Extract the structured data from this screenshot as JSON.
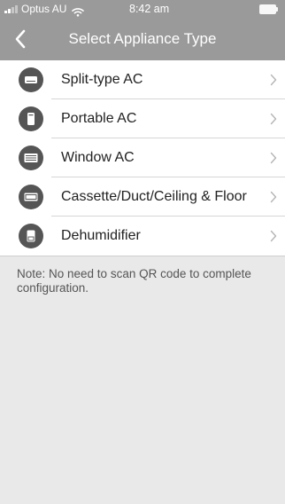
{
  "status_bar": {
    "carrier": "Optus AU",
    "time": "8:42 am",
    "icons": [
      "signal-icon",
      "wifi-icon",
      "battery-icon"
    ]
  },
  "nav": {
    "title": "Select Appliance Type",
    "back_icon": "chevron-left-icon"
  },
  "appliances": [
    {
      "label": "Split-type AC",
      "icon": "split-ac-icon"
    },
    {
      "label": "Portable AC",
      "icon": "portable-ac-icon"
    },
    {
      "label": "Window AC",
      "icon": "window-ac-icon"
    },
    {
      "label": "Cassette/Duct/Ceiling & Floor",
      "icon": "cassette-ac-icon"
    },
    {
      "label": "Dehumidifier",
      "icon": "dehumidifier-icon"
    }
  ],
  "note": "Note: No need to scan QR code to complete configuration.",
  "colors": {
    "header": "#9a9a9a",
    "background": "#e9e9e9",
    "list_background": "#ffffff",
    "icon_circle": "#555555",
    "text": "#222222",
    "note_text": "#555555"
  }
}
